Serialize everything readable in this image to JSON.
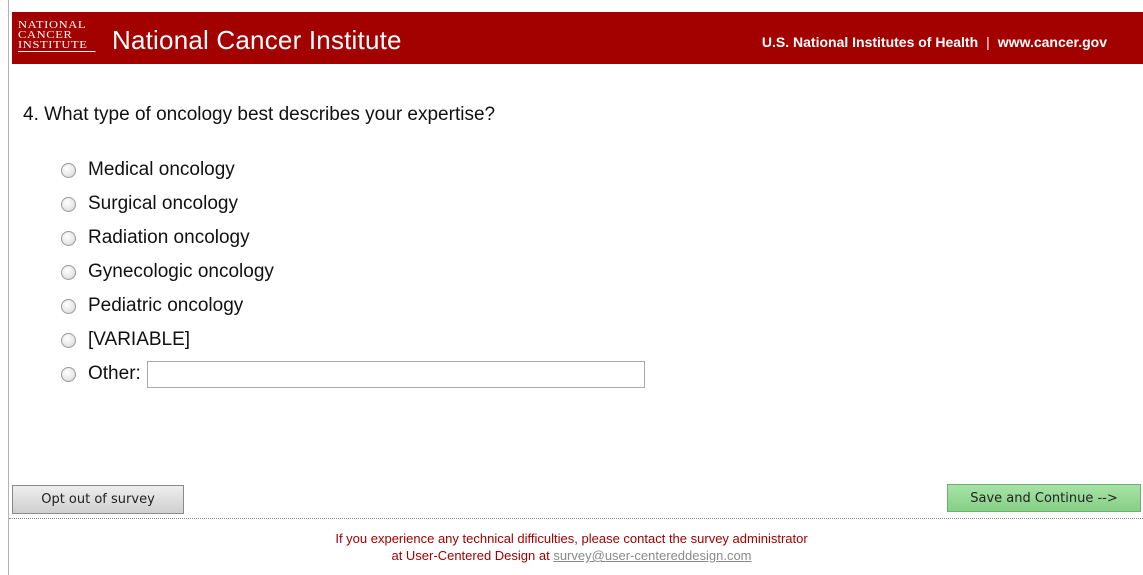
{
  "header": {
    "logo_lines": [
      "NATIONAL",
      "CANCER",
      "INSTITUTE"
    ],
    "title": "National Cancer Institute",
    "link_nih": "U.S. National Institutes of Health",
    "separator": "|",
    "link_site": "www.cancer.gov"
  },
  "question": {
    "text": "4. What type of oncology best describes your expertise?",
    "options": [
      "Medical oncology",
      "Surgical oncology",
      "Radiation oncology",
      "Gynecologic oncology",
      "Pediatric oncology",
      "[VARIABLE]",
      "Other:"
    ],
    "other_value": ""
  },
  "buttons": {
    "opt_out": "Opt out of survey",
    "save_continue": "Save and Continue -->"
  },
  "footer": {
    "line1": "If you experience any technical difficulties, please contact the survey administrator",
    "line2_prefix": "at User-Centered Design at ",
    "email": "survey@user-centereddesign.com"
  },
  "colors": {
    "header_bg": "#a30000",
    "save_button_bg": "#97d997",
    "footer_text": "#a30000"
  }
}
